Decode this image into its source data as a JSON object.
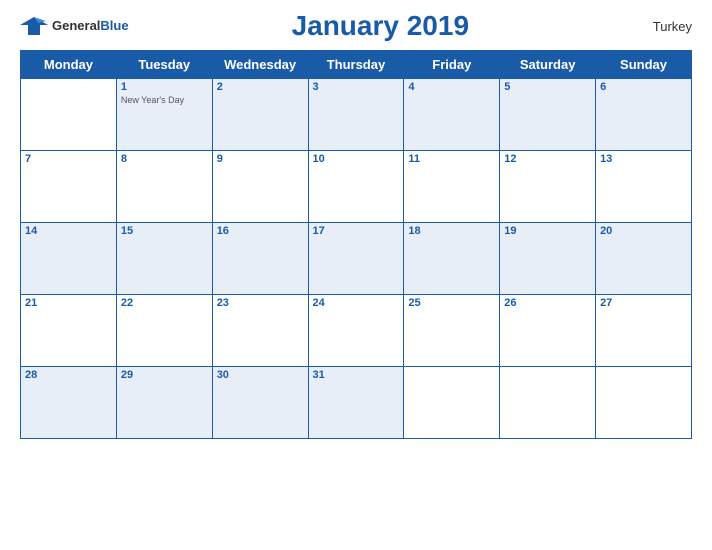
{
  "header": {
    "logo_general": "General",
    "logo_blue": "Blue",
    "title": "January 2019",
    "country": "Turkey"
  },
  "days_of_week": [
    "Monday",
    "Tuesday",
    "Wednesday",
    "Thursday",
    "Friday",
    "Saturday",
    "Sunday"
  ],
  "weeks": [
    [
      {
        "day": "",
        "holiday": ""
      },
      {
        "day": "1",
        "holiday": "New Year's Day"
      },
      {
        "day": "2",
        "holiday": ""
      },
      {
        "day": "3",
        "holiday": ""
      },
      {
        "day": "4",
        "holiday": ""
      },
      {
        "day": "5",
        "holiday": ""
      },
      {
        "day": "6",
        "holiday": ""
      }
    ],
    [
      {
        "day": "7",
        "holiday": ""
      },
      {
        "day": "8",
        "holiday": ""
      },
      {
        "day": "9",
        "holiday": ""
      },
      {
        "day": "10",
        "holiday": ""
      },
      {
        "day": "11",
        "holiday": ""
      },
      {
        "day": "12",
        "holiday": ""
      },
      {
        "day": "13",
        "holiday": ""
      }
    ],
    [
      {
        "day": "14",
        "holiday": ""
      },
      {
        "day": "15",
        "holiday": ""
      },
      {
        "day": "16",
        "holiday": ""
      },
      {
        "day": "17",
        "holiday": ""
      },
      {
        "day": "18",
        "holiday": ""
      },
      {
        "day": "19",
        "holiday": ""
      },
      {
        "day": "20",
        "holiday": ""
      }
    ],
    [
      {
        "day": "21",
        "holiday": ""
      },
      {
        "day": "22",
        "holiday": ""
      },
      {
        "day": "23",
        "holiday": ""
      },
      {
        "day": "24",
        "holiday": ""
      },
      {
        "day": "25",
        "holiday": ""
      },
      {
        "day": "26",
        "holiday": ""
      },
      {
        "day": "27",
        "holiday": ""
      }
    ],
    [
      {
        "day": "28",
        "holiday": ""
      },
      {
        "day": "29",
        "holiday": ""
      },
      {
        "day": "30",
        "holiday": ""
      },
      {
        "day": "31",
        "holiday": ""
      },
      {
        "day": "",
        "holiday": ""
      },
      {
        "day": "",
        "holiday": ""
      },
      {
        "day": "",
        "holiday": ""
      }
    ]
  ]
}
